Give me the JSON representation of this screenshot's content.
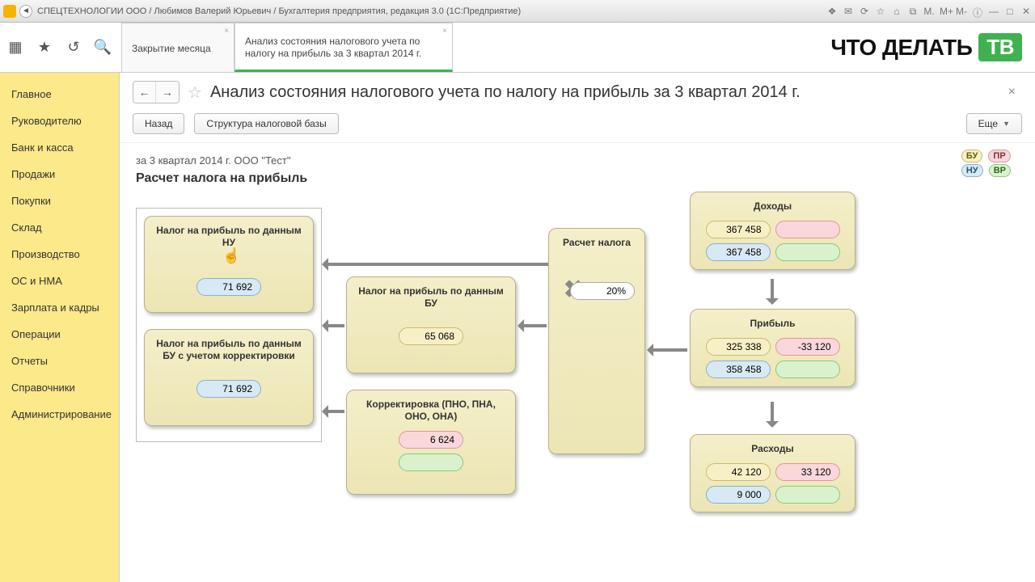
{
  "titlebar": "СПЕЦТЕХНОЛОГИИ ООО / Любимов Валерий Юрьевич / Бухгалтерия предприятия, редакция 3.0  (1С:Предприятие)",
  "brand": {
    "text": "ЧТО ДЕЛАТЬ",
    "badge": "ТВ"
  },
  "tabs": [
    {
      "label": "Закрытие месяца"
    },
    {
      "label": "Анализ состояния налогового учета по налогу на прибыль за 3 квартал 2014 г."
    }
  ],
  "sidebar": [
    "Главное",
    "Руководителю",
    "Банк и касса",
    "Продажи",
    "Покупки",
    "Склад",
    "Производство",
    "ОС и НМА",
    "Зарплата и кадры",
    "Операции",
    "Отчеты",
    "Справочники",
    "Администрирование"
  ],
  "header": {
    "title": "Анализ состояния налогового учета по налогу на прибыль за 3 квартал 2014 г.",
    "back": "Назад",
    "structure": "Структура налоговой базы",
    "more": "Еще"
  },
  "canvas": {
    "period": "за 3 квартал 2014 г. ООО \"Тест\"",
    "section": "Расчет налога на прибыль",
    "legend": {
      "bu": "БУ",
      "pr": "ПР",
      "nu": "НУ",
      "vr": "ВР"
    },
    "boxes": {
      "tax_nu": {
        "title": "Налог на прибыль по данным НУ",
        "value": "71 692"
      },
      "tax_bu_corr": {
        "title": "Налог на прибыль по данным БУ с учетом корректировки",
        "value": "71 692"
      },
      "tax_bu": {
        "title": "Налог на прибыль по данным БУ",
        "value": "65 068"
      },
      "correction": {
        "title": "Корректировка (ПНО, ПНА, ОНО, ОНА)",
        "pr": "6 624",
        "vr": ""
      },
      "calc": {
        "title": "Расчет налога",
        "rate": "20%"
      },
      "income": {
        "title": "Доходы",
        "bu": "367 458",
        "pr": "",
        "nu": "367 458",
        "vr": ""
      },
      "profit": {
        "title": "Прибыль",
        "bu": "325 338",
        "pr": "-33 120",
        "nu": "358 458",
        "vr": ""
      },
      "expense": {
        "title": "Расходы",
        "bu": "42 120",
        "pr": "33 120",
        "nu": "9 000",
        "vr": ""
      }
    }
  }
}
